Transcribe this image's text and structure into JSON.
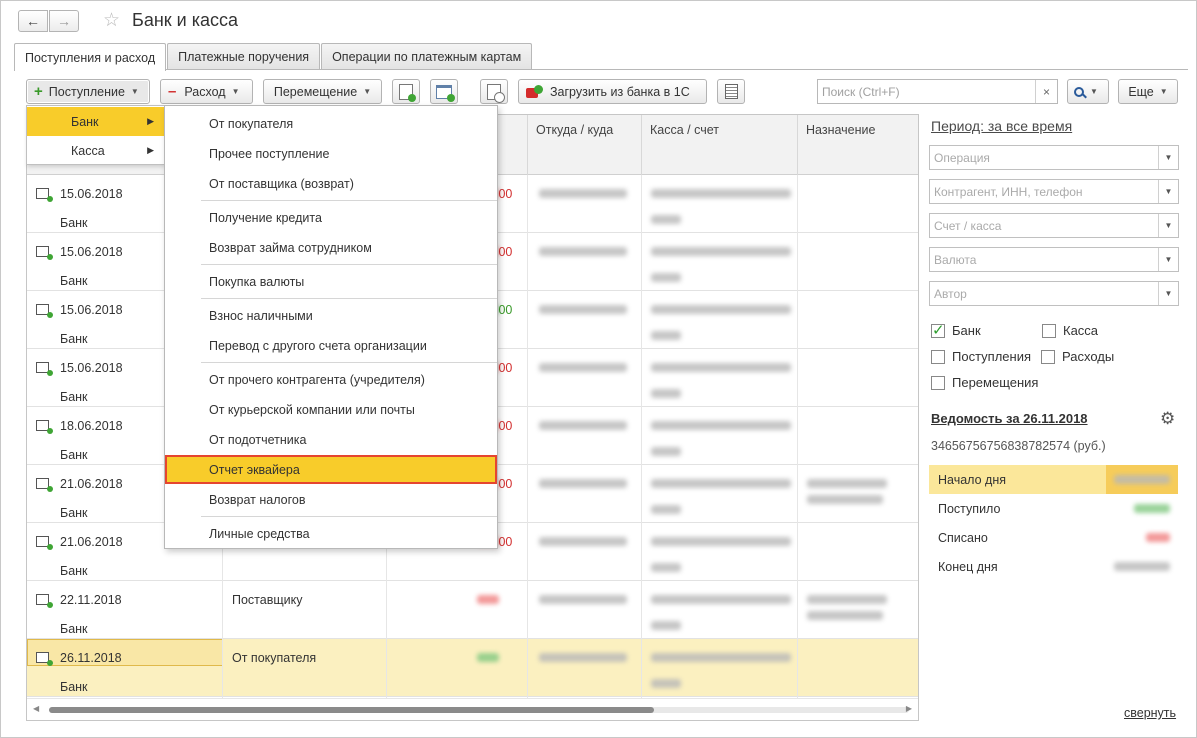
{
  "title": "Банк и касса",
  "tabs": [
    {
      "label": "Поступления и расход",
      "active": true
    },
    {
      "label": "Платежные поручения",
      "active": false
    },
    {
      "label": "Операции по платежным картам",
      "active": false
    }
  ],
  "toolbar": {
    "income_label": "Поступление",
    "expense_label": "Расход",
    "move_label": "Перемещение",
    "load_label": "Загрузить из банка в 1С",
    "search_placeholder": "Поиск (Ctrl+F)",
    "search_clear": "×",
    "more_label": "Еще"
  },
  "columns": {
    "from_to": "Откуда / куда",
    "account": "Касса / счет",
    "purpose": "Назначение"
  },
  "rows": [
    {
      "date": "15.06.2018",
      "type": "Банк",
      "operation": "",
      "amount_color": "red",
      "amount_text": ",00"
    },
    {
      "date": "15.06.2018",
      "type": "Банк",
      "operation": "",
      "amount_color": "red",
      "amount_text": ",00"
    },
    {
      "date": "15.06.2018",
      "type": "Банк",
      "operation": "",
      "amount_color": "green",
      "amount_text": ",00"
    },
    {
      "date": "15.06.2018",
      "type": "Банк",
      "operation": "",
      "amount_color": "red",
      "amount_text": ",00"
    },
    {
      "date": "18.06.2018",
      "type": "Банк",
      "operation": "",
      "amount_color": "red",
      "amount_text": ",00"
    },
    {
      "date": "21.06.2018",
      "type": "Банк",
      "operation": "",
      "amount_color": "red",
      "amount_text": ",00"
    },
    {
      "date": "21.06.2018",
      "type": "Банк",
      "operation": "",
      "amount_color": "red",
      "amount_text": ",00"
    },
    {
      "date": "22.11.2018",
      "type": "Банк",
      "operation": "Поставщику",
      "amount_color": "red",
      "amount_text": ""
    },
    {
      "date": "26.11.2018",
      "type": "Банк",
      "operation": "От покупателя",
      "amount_color": "green",
      "amount_text": "",
      "selected": true
    }
  ],
  "menu_level1": [
    {
      "label": "Банк",
      "active": true
    },
    {
      "label": "Касса",
      "active": false
    }
  ],
  "menu_level2": [
    "От покупателя",
    "Прочее поступление",
    "От поставщика (возврат)",
    "Получение кредита",
    "Возврат займа сотрудником",
    "Покупка валюты",
    "Взнос наличными",
    "Перевод с другого счета организации",
    "От прочего контрагента (учредителя)",
    "От курьерской компании или почты",
    "От подотчетника",
    "Отчет эквайера",
    "Возврат налогов",
    "Личные средства"
  ],
  "panel": {
    "period": "Период: за все время",
    "filters": [
      "Операция",
      "Контрагент, ИНН, телефон",
      "Счет / касса",
      "Валюта",
      "Автор"
    ],
    "checkboxes": [
      {
        "label": "Банк",
        "checked": true
      },
      {
        "label": "Касса",
        "checked": false
      },
      {
        "label": "Поступления",
        "checked": false
      },
      {
        "label": "Расходы",
        "checked": false
      },
      {
        "label": "Перемещения",
        "checked": false
      }
    ],
    "statement": "Ведомость за 26.11.2018",
    "account_number": "34656756756838782574 (руб.)",
    "summary": [
      "Начало дня",
      "Поступило",
      "Списано",
      "Конец дня"
    ],
    "collapse": "свернуть"
  },
  "colors": {
    "accent": "#f8cc2a",
    "highlight_border": "#e5452f",
    "selected_row": "#fbf0c0"
  }
}
